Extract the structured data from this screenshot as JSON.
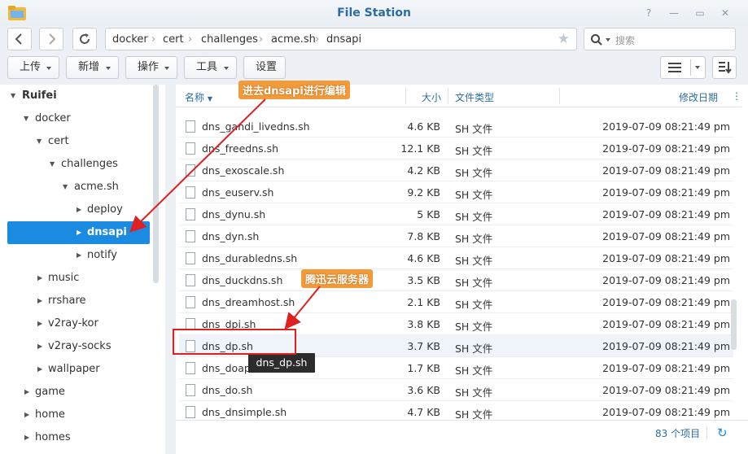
{
  "window": {
    "title": "File Station"
  },
  "path": {
    "segments": [
      "docker",
      "cert",
      "challenges",
      "acme.sh",
      "dnsapi"
    ]
  },
  "search": {
    "placeholder": "搜索"
  },
  "toolbar": {
    "upload": "上传",
    "new": "新增",
    "action": "操作",
    "tools": "工具",
    "settings": "设置"
  },
  "tree": {
    "items": [
      {
        "label": "Ruifei",
        "expanded": true,
        "bold": true
      },
      {
        "label": "docker",
        "expanded": true
      },
      {
        "label": "cert",
        "expanded": true
      },
      {
        "label": "challenges",
        "expanded": true
      },
      {
        "label": "acme.sh",
        "expanded": true
      },
      {
        "label": "deploy",
        "expanded": false
      },
      {
        "label": "dnsapi",
        "expanded": false,
        "selected": true
      },
      {
        "label": "notify",
        "expanded": false
      },
      {
        "label": "music",
        "expanded": false
      },
      {
        "label": "rrshare",
        "expanded": false
      },
      {
        "label": "v2ray-kor",
        "expanded": false
      },
      {
        "label": "v2ray-socks",
        "expanded": false
      },
      {
        "label": "wallpaper",
        "expanded": false
      },
      {
        "label": "game",
        "expanded": false
      },
      {
        "label": "home",
        "expanded": false
      },
      {
        "label": "homes",
        "expanded": false
      }
    ]
  },
  "columns": {
    "name": "名称",
    "size": "大小",
    "type": "文件类型",
    "modified": "修改日期"
  },
  "files": [
    {
      "name": "dns_gandi_livedns.sh",
      "size": "4.6 KB",
      "type": "SH 文件",
      "modified": "2019-07-09 08:21:49 pm"
    },
    {
      "name": "dns_freedns.sh",
      "size": "12.1 KB",
      "type": "SH 文件",
      "modified": "2019-07-09 08:21:49 pm"
    },
    {
      "name": "dns_exoscale.sh",
      "size": "4.2 KB",
      "type": "SH 文件",
      "modified": "2019-07-09 08:21:49 pm"
    },
    {
      "name": "dns_euserv.sh",
      "size": "9.2 KB",
      "type": "SH 文件",
      "modified": "2019-07-09 08:21:49 pm"
    },
    {
      "name": "dns_dynu.sh",
      "size": "5 KB",
      "type": "SH 文件",
      "modified": "2019-07-09 08:21:49 pm"
    },
    {
      "name": "dns_dyn.sh",
      "size": "7.8 KB",
      "type": "SH 文件",
      "modified": "2019-07-09 08:21:49 pm"
    },
    {
      "name": "dns_durabledns.sh",
      "size": "4.6 KB",
      "type": "SH 文件",
      "modified": "2019-07-09 08:21:49 pm"
    },
    {
      "name": "dns_duckdns.sh",
      "size": "3.5 KB",
      "type": "SH 文件",
      "modified": "2019-07-09 08:21:49 pm"
    },
    {
      "name": "dns_dreamhost.sh",
      "size": "2.1 KB",
      "type": "SH 文件",
      "modified": "2019-07-09 08:21:49 pm"
    },
    {
      "name": "dns_dpi.sh",
      "size": "3.8 KB",
      "type": "SH 文件",
      "modified": "2019-07-09 08:21:49 pm"
    },
    {
      "name": "dns_dp.sh",
      "size": "3.7 KB",
      "type": "SH 文件",
      "modified": "2019-07-09 08:21:49 pm",
      "hover": true
    },
    {
      "name": "dns_doapi.sh",
      "size": "1.7 KB",
      "type": "SH 文件",
      "modified": "2019-07-09 08:21:49 pm"
    },
    {
      "name": "dns_do.sh",
      "size": "3.6 KB",
      "type": "SH 文件",
      "modified": "2019-07-09 08:21:49 pm"
    },
    {
      "name": "dns_dnsimple.sh",
      "size": "4.7 KB",
      "type": "SH 文件",
      "modified": "2019-07-09 08:21:49 pm"
    }
  ],
  "footer": {
    "count": "83 个项目"
  },
  "tooltip": {
    "text": "dns_dp.sh"
  },
  "annotations": {
    "edit_dnsapi": "进去dnsapi进行编辑",
    "tencent_cloud": "腾迅云服务器"
  },
  "colors": {
    "accent": "#1a8be0",
    "title": "#2d6ca2",
    "annotation_red": "#e02020",
    "annotation_label": "#f29b3a"
  }
}
